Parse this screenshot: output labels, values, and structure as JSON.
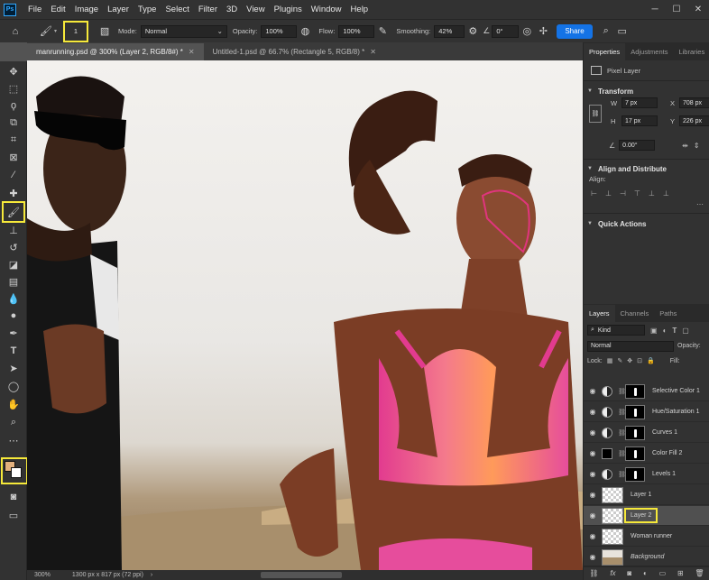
{
  "app": {
    "logo": "Ps"
  },
  "menu": [
    "File",
    "Edit",
    "Image",
    "Layer",
    "Type",
    "Select",
    "Filter",
    "3D",
    "View",
    "Plugins",
    "Window",
    "Help"
  ],
  "options": {
    "brush_size": "1",
    "mode_label": "Mode:",
    "mode_value": "Normal",
    "opacity_label": "Opacity:",
    "opacity_value": "100%",
    "flow_label": "Flow:",
    "flow_value": "100%",
    "smoothing_label": "Smoothing:",
    "smoothing_value": "42%",
    "angle_value": "0°",
    "share_label": "Share"
  },
  "tabs": [
    {
      "label": "manrunning.psd @ 300% (Layer 2, RGB/8#) *",
      "active": true
    },
    {
      "label": "Untitled-1.psd @ 66.7% (Rectangle 5, RGB/8) *",
      "active": false
    }
  ],
  "status": {
    "zoom": "300%",
    "doc_size": "1300 px x 817 px (72 ppi)"
  },
  "colors": {
    "foreground": "#e2b07e",
    "background": "#ffffff",
    "highlight": "#f6e93a",
    "accent": "#1473e6"
  },
  "properties": {
    "tabs": [
      "Properties",
      "Adjustments",
      "Libraries"
    ],
    "kind": "Pixel Layer",
    "transform_title": "Transform",
    "w_label": "W",
    "w_value": "7 px",
    "h_label": "H",
    "h_value": "17 px",
    "x_label": "X",
    "x_value": "708 px",
    "y_label": "Y",
    "y_value": "226 px",
    "angle_value": "0.00°",
    "align_title": "Align and Distribute",
    "align_label": "Align:",
    "quick_title": "Quick Actions"
  },
  "layers_panel": {
    "tabs": [
      "Layers",
      "Channels",
      "Paths"
    ],
    "kind_label": "Kind",
    "blend_mode": "Normal",
    "opacity_label": "Opacity:",
    "lock_label": "Lock:",
    "fill_label": "Fill:",
    "layers": [
      {
        "name": "Selective Color 1",
        "type": "adjustment"
      },
      {
        "name": "Hue/Saturation 1",
        "type": "adjustment"
      },
      {
        "name": "Curves 1",
        "type": "adjustment"
      },
      {
        "name": "Color Fill 2",
        "type": "fill"
      },
      {
        "name": "Levels 1",
        "type": "adjustment"
      },
      {
        "name": "Layer 1",
        "type": "pixel"
      },
      {
        "name": "Layer 2",
        "type": "pixel",
        "selected": true
      },
      {
        "name": "Woman runner",
        "type": "pixel"
      },
      {
        "name": "Background",
        "type": "image"
      }
    ]
  }
}
